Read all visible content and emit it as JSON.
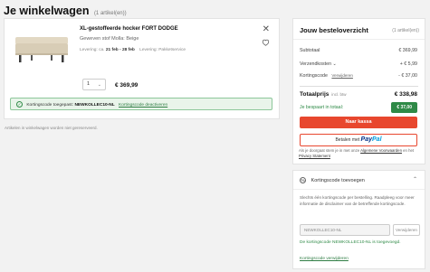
{
  "page": {
    "title": "Je winkelwagen",
    "count": "(1 artikel(en))"
  },
  "product": {
    "name": "XL-gestoffeerde hocker FORT DODGE",
    "variant": "Geweven stof Molla: Beige",
    "delivery_label": "Levering: ca.",
    "delivery_dates": "21 feb - 28 feb",
    "delivery_service": "Levering: Pakketservice",
    "quantity": "1",
    "price": "€ 369,99",
    "image_color": "#d8cdb6"
  },
  "discount_banner": {
    "text": "Kortingscode toegepast:",
    "code": "NEWKOLLEC10-NL",
    "link": "Kortingscode deactiveren"
  },
  "saved_note": "Artikelen in winkelwagen worden niet gereserveerd.",
  "summary": {
    "title": "Jouw besteloverzicht",
    "count": "(1 artikel(en))",
    "subtotal_label": "Subtotaal",
    "subtotal_value": "€ 369,99",
    "shipping_label": "Verzendkosten",
    "shipping_value": "+ € 5,99",
    "discount_label": "Kortingscode",
    "discount_link": "Verwijderen",
    "discount_value": "- € 37,00",
    "total_label": "Totaalprijs",
    "total_incl": "incl. btw",
    "total_value": "€ 338,98",
    "saved_label": "Je bespaart in totaal:",
    "saved_value": "€ 37,00",
    "checkout_label": "Naar kassa",
    "paypal_prefix": "Betalen met",
    "paypal_p1": "Pay",
    "paypal_p2": "Pal",
    "accent_color": "#e8472e",
    "green_color": "#2f8a47"
  },
  "terms": {
    "text": "Als je doorgaat stem je in met onze",
    "link1": "Algemene Voorwaarden",
    "mid": "en het",
    "link2": "Privacy Statement"
  },
  "discount_panel": {
    "title": "Kortingscode toevoegen",
    "info": "Slechts één kortingscode per bestelling. Raadpleeg voor meer informatie de disclaimer van de betreffende kortingscode.",
    "input_value": "NEWKOLLEC10-NL",
    "remove_button": "Verwijderen",
    "applied_text": "De kortingscode NEWKOLLEC10-NL is toegevoegd.",
    "applied_link": "Kortingscode verwijderen"
  }
}
